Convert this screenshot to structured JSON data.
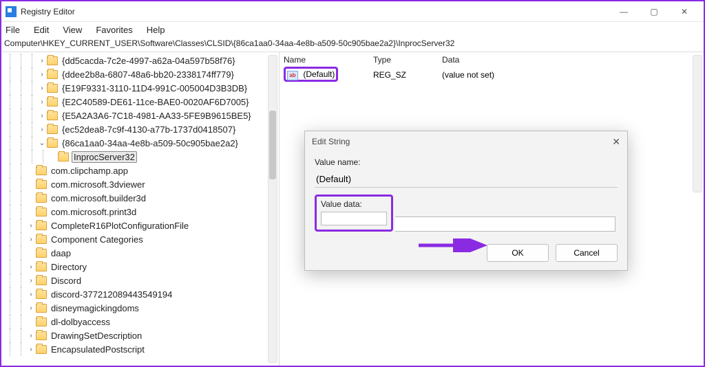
{
  "window": {
    "title": "Registry Editor",
    "controls": {
      "min": "—",
      "max": "▢",
      "close": "✕"
    }
  },
  "menu": {
    "file": "File",
    "edit": "Edit",
    "view": "View",
    "favorites": "Favorites",
    "help": "Help"
  },
  "address": "Computer\\HKEY_CURRENT_USER\\Software\\Classes\\CLSID\\{86ca1aa0-34aa-4e8b-a509-50c905bae2a2}\\InprocServer32",
  "tree": [
    {
      "indent": 3,
      "chev": ">",
      "label": "{dd5cacda-7c2e-4997-a62a-04a597b58f76}"
    },
    {
      "indent": 3,
      "chev": ">",
      "label": "{ddee2b8a-6807-48a6-bb20-2338174ff779}"
    },
    {
      "indent": 3,
      "chev": ">",
      "label": "{E19F9331-3110-11D4-991C-005004D3B3DB}"
    },
    {
      "indent": 3,
      "chev": ">",
      "label": "{E2C40589-DE61-11ce-BAE0-0020AF6D7005}"
    },
    {
      "indent": 3,
      "chev": ">",
      "label": "{E5A2A3A6-7C18-4981-AA33-5FE9B9615BE5}"
    },
    {
      "indent": 3,
      "chev": ">",
      "label": "{ec52dea8-7c9f-4130-a77b-1737d0418507}"
    },
    {
      "indent": 3,
      "chev": "v",
      "label": "{86ca1aa0-34aa-4e8b-a509-50c905bae2a2}"
    },
    {
      "indent": 4,
      "chev": "",
      "label": "InprocServer32",
      "selected": true
    },
    {
      "indent": 2,
      "chev": "",
      "label": "com.clipchamp.app"
    },
    {
      "indent": 2,
      "chev": "",
      "label": "com.microsoft.3dviewer"
    },
    {
      "indent": 2,
      "chev": "",
      "label": "com.microsoft.builder3d"
    },
    {
      "indent": 2,
      "chev": "",
      "label": "com.microsoft.print3d"
    },
    {
      "indent": 2,
      "chev": ">",
      "label": "CompleteR16PlotConfigurationFile"
    },
    {
      "indent": 2,
      "chev": ">",
      "label": "Component Categories"
    },
    {
      "indent": 2,
      "chev": "",
      "label": "daap"
    },
    {
      "indent": 2,
      "chev": ">",
      "label": "Directory"
    },
    {
      "indent": 2,
      "chev": ">",
      "label": "Discord"
    },
    {
      "indent": 2,
      "chev": ">",
      "label": "discord-377212089443549194"
    },
    {
      "indent": 2,
      "chev": ">",
      "label": "disneymagickingdoms"
    },
    {
      "indent": 2,
      "chev": "",
      "label": "dl-dolbyaccess"
    },
    {
      "indent": 2,
      "chev": ">",
      "label": "DrawingSetDescription"
    },
    {
      "indent": 2,
      "chev": ">",
      "label": "EncapsulatedPostscript"
    }
  ],
  "list": {
    "headers": {
      "name": "Name",
      "type": "Type",
      "data": "Data"
    },
    "row": {
      "icon": "ab",
      "name": "(Default)",
      "type": "REG_SZ",
      "data": "(value not set)"
    }
  },
  "dialog": {
    "title": "Edit String",
    "value_name_label": "Value name:",
    "value_name": "(Default)",
    "value_data_label": "Value data:",
    "value_data": "",
    "ok": "OK",
    "cancel": "Cancel",
    "close": "✕"
  }
}
